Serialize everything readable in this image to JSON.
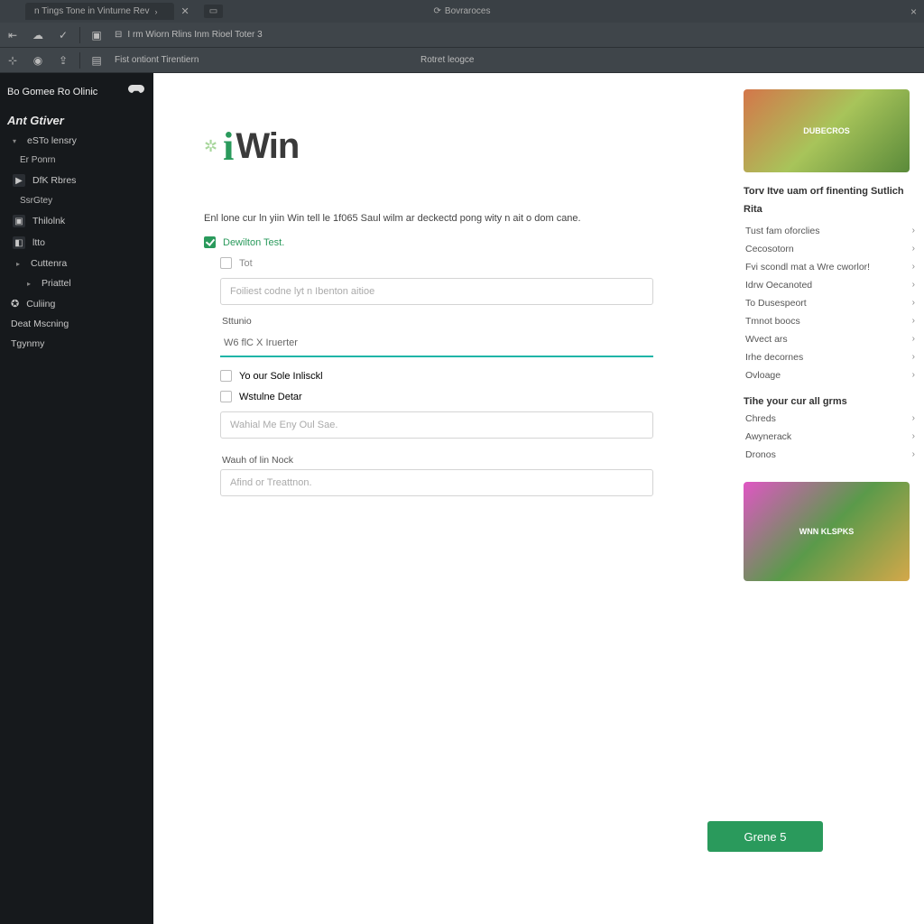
{
  "titlebar": {
    "tab_label": "n Tings  Tone in Vinturne Rev",
    "center_label": "Bovraroces",
    "close": "×"
  },
  "toolbar": {
    "row1_crumb": "I rm Wiorn Rlins Inm Rioel Toter 3",
    "row2_crumb": "Fist ontiont Tirentiern",
    "row2_crumb2": "Rotret leogce"
  },
  "sidebar": {
    "brand": "Bo Gomee Ro Olinic",
    "section": "Ant Gtiver",
    "items": [
      {
        "label": "eSTo lensry",
        "caret": true
      },
      {
        "label": "Er Ponrn",
        "sub": true
      },
      {
        "label": "DfK Rbres",
        "ico": true
      },
      {
        "label": "SsrGtey",
        "sub": true
      },
      {
        "label": "Thilolnk",
        "ico": true
      },
      {
        "label": "ltto",
        "ico": true
      },
      {
        "label": "Cuttenra",
        "caret": true,
        "sub2": true
      },
      {
        "label": "Priattel",
        "caret": true,
        "sub3": true
      },
      {
        "label": "Culiing",
        "ico": true,
        "plain": true
      },
      {
        "label": "Deat Mscning",
        "plain": true
      },
      {
        "label": "Tgynmy",
        "plain": true
      }
    ]
  },
  "form": {
    "intro": "Enl lone cur ln yiin Win tell le 1f065 Saul wilm ar deckectd pong wity n ait o dom cane.",
    "chk1_label": "Dewilton Test.",
    "chk2_label": "Tot",
    "input1_placeholder": "Foiliest codne lyt n Ibenton aitioe",
    "label2": "Sttunio",
    "input2_value": "W6 flC X Iruerter",
    "chk3_label": "Yo our Sole Inlisckl",
    "chk4_label": "Wstulne Detar",
    "input3_placeholder": "Wahial Me Eny Oul Sae.",
    "label4": "Wauh of lin Nock",
    "input4_placeholder": "Afind or Treattnon.",
    "cta": "Grene 5"
  },
  "right": {
    "promo1": "DUBECROS",
    "heading1": "Torv Itve uam orf finenting Sutlich",
    "heading1b": "Rita",
    "links": [
      "Tust fam oforclies",
      "Cecosotorn",
      "Fvi scondl mat a Wre cworlor!",
      "Idrw Oecanoted",
      "To Dusespeort",
      "Tmnot boocs",
      "Wvect ars",
      "Irhe decornes",
      "Ovloage"
    ],
    "heading2": "Tihe your cur all grms",
    "links2": [
      "Chreds",
      "Awynerack",
      "Dronos"
    ],
    "promo2": "WNN KLSPKS"
  }
}
